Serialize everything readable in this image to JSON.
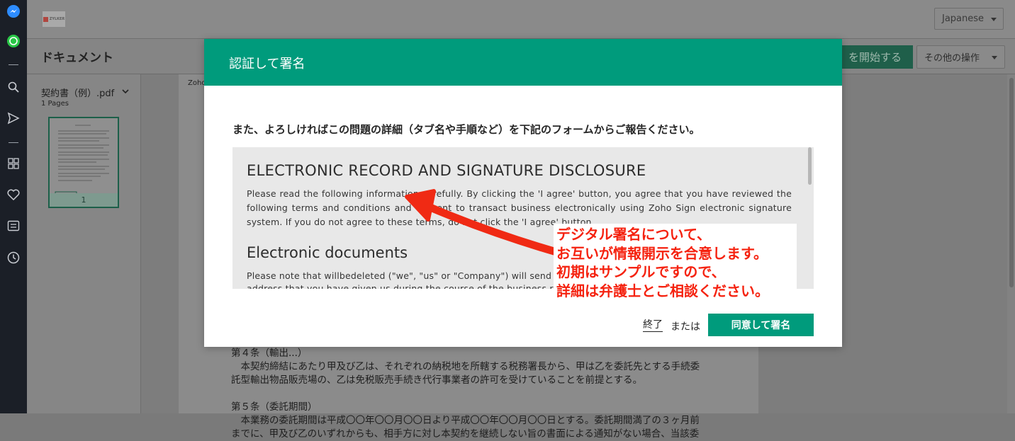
{
  "dock": {
    "icons": [
      "messenger-icon",
      "whatsapp-icon",
      "search-icon",
      "send-icon",
      "apps-icon",
      "heart-icon",
      "notes-icon",
      "clock-icon"
    ]
  },
  "topbar": {
    "logo_text": "ZYLKER",
    "language": "Japanese"
  },
  "subbar": {
    "heading": "ドキュメント",
    "start_button": "を開始する",
    "more_button": "その他の操作"
  },
  "doc_panel": {
    "file_name": "契約書（例）.pdf",
    "page_count": "1 Pages",
    "thumb_page_number": "1"
  },
  "viewer": {
    "corner_text": "Zoho",
    "body_lines": [
      "第４条（輸出...）",
      "　本契約締結にあたり甲及び乙は、それぞれの納税地を所轄する税務署長から、甲は乙を委託先とする手続委",
      "託型輸出物品販売場の、乙は免税販売手続き代行事業者の許可を受けていることを前提とする。",
      "",
      "第５条（委託期間）",
      "　本業務の委託期間は平成〇〇年〇〇月〇〇日より平成〇〇年〇〇月〇〇日とする。委託期間満了の３ヶ月前",
      "までに、甲及び乙のいずれからも、相手方に対し本契約を継続しない旨の書面による通知がない場合、当該委"
    ]
  },
  "modal": {
    "title": "認証して署名",
    "lead": "また、よろしければこの問題の詳細（タブ名や手順など）を下記のフォームからご報告ください。",
    "disclosure": {
      "title": "ELECTRONIC RECORD AND SIGNATURE DISCLOSURE",
      "para1": "Please read the following information carefully. By clicking the 'I agree' button, you agree that you have reviewed the following terms and conditions and consent to transact business electronically using Zoho Sign electronic signature system. If you do not agree to these terms, do not click the 'I agree' button.",
      "subtitle": "Electronic documents",
      "para2": "Please note that willbedeleted (\"we\", \"us\" or \"Company\") will send all documents electronically to you to the email",
      "para2_cut": "address that you have given us during the course of the business relationship"
    },
    "finish_link": "終了",
    "or_text": "または",
    "agree_button": "同意して署名"
  },
  "callout": {
    "lines": [
      "デジタル署名について、",
      "お互いが情報開示を合意します。",
      "初期はサンプルですので、",
      "詳細は弁護士とご相談ください。"
    ]
  },
  "colors": {
    "accent": "#009b7c",
    "dock": "#1b1f27",
    "annotation": "#f5220f"
  }
}
